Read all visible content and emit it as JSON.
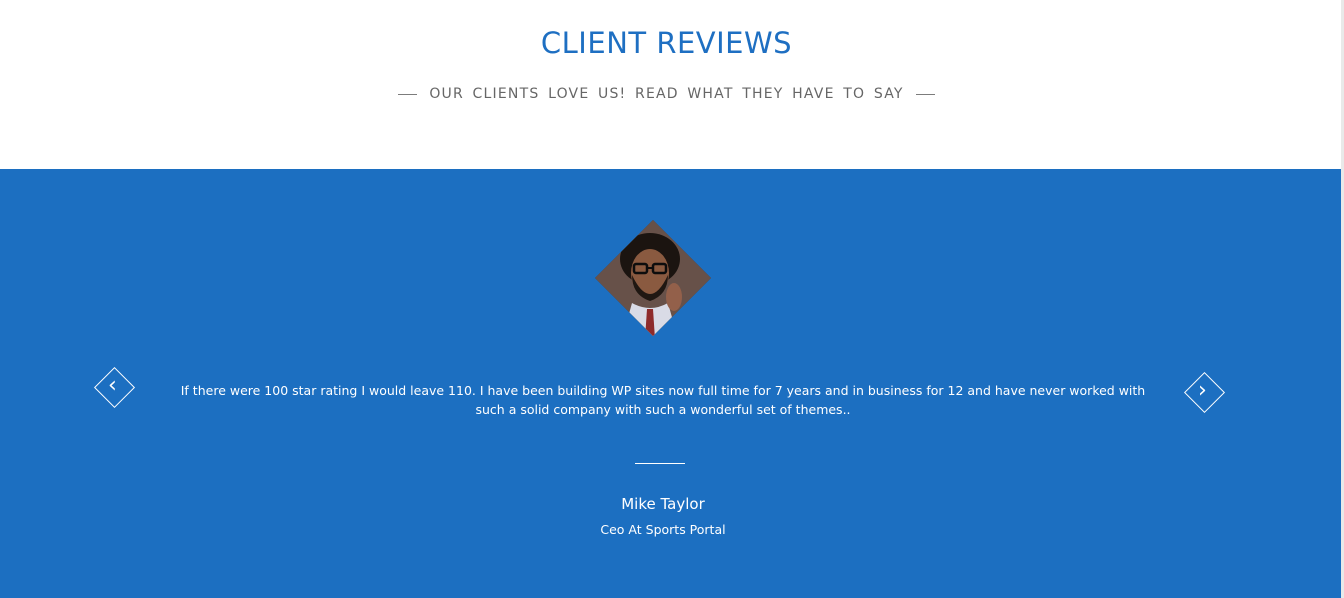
{
  "section": {
    "title": "CLIENT REVIEWS",
    "subtitle": "OUR CLIENTS LOVE US! READ WHAT THEY HAVE TO SAY"
  },
  "testimonial": {
    "quote": "If there were 100 star rating I would leave 110. I have been building WP sites now full time for 7 years and in business for 12 and have never worked with such a solid company with such a wonderful set of themes..",
    "name": "Mike Taylor",
    "role": "Ceo At Sports Portal"
  },
  "icons": {
    "prev": "chevron-left-icon",
    "next": "chevron-right-icon"
  },
  "colors": {
    "accent": "#1e6fc2",
    "band": "#1c6fc1",
    "subtitle": "#666666"
  }
}
